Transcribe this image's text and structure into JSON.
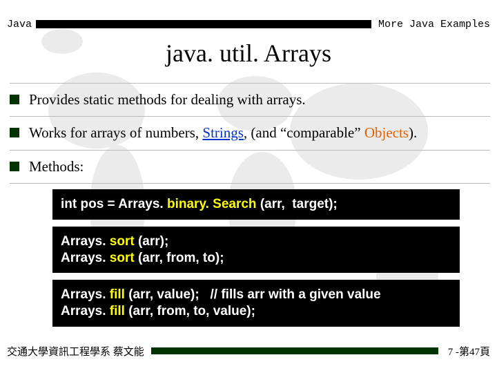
{
  "header": {
    "left": "Java",
    "right": "More Java Examples"
  },
  "title": "java. util. Arrays",
  "bullets": [
    {
      "html": "Provides static methods for dealing with arrays."
    },
    {
      "html": "Works for arrays of numbers, <span class='lnk'>Strings</span>, (and “comparable” <span class='hot'>Objects</span>)."
    },
    {
      "html": "Methods:"
    }
  ],
  "code": [
    {
      "html": "int pos = Arrays. <span class='method'>binary. Search</span> (arr,&nbsp; target);"
    },
    {
      "html": "Arrays. <span class='method'>sort</span> (arr);<br>Arrays. <span class='method'>sort</span> (arr, from, to);"
    },
    {
      "html": "Arrays. <span class='method'>fill</span> (arr, value);&nbsp;&nbsp;&nbsp;<span class='cmt'>// fills arr with a given value</span><br>Arrays. <span class='method'>fill</span> (arr, from, to, value);"
    }
  ],
  "footer": {
    "left": "交通大學資訊工程學系 蔡文能",
    "right": "7 -第47頁"
  }
}
